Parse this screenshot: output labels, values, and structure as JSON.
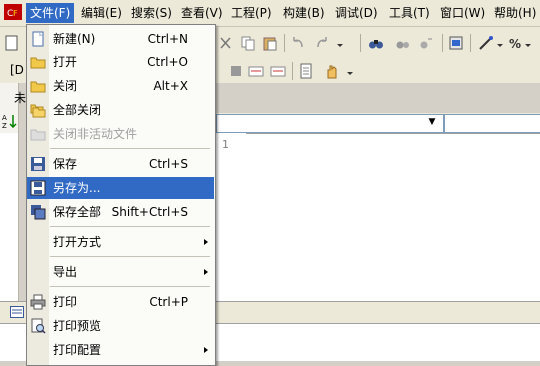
{
  "menubar": {
    "items": [
      {
        "label": "文件(F)",
        "active": true
      },
      {
        "label": "编辑(E)"
      },
      {
        "label": "搜索(S)"
      },
      {
        "label": "查看(V)"
      },
      {
        "label": "工程(P)"
      },
      {
        "label": "构建(B)"
      },
      {
        "label": "调试(D)"
      },
      {
        "label": "工具(T)"
      },
      {
        "label": "窗口(W)"
      },
      {
        "label": "帮助(H)"
      }
    ]
  },
  "toolbar": {
    "partial_left_label": "[D",
    "partial_tab_label": "未"
  },
  "editor": {
    "line_numbers": [
      "1"
    ]
  },
  "file_menu": {
    "items": [
      {
        "label": "新建(N)",
        "shortcut": "Ctrl+N",
        "icon": "new-file-icon"
      },
      {
        "label": "打开",
        "shortcut": "Ctrl+O",
        "icon": "open-folder-icon"
      },
      {
        "label": "关闭",
        "shortcut": "Alt+X",
        "icon": "close-folder-icon"
      },
      {
        "label": "全部关闭",
        "shortcut": "",
        "icon": "close-all-icon"
      },
      {
        "label": "关闭非活动文件",
        "shortcut": "",
        "icon": "close-inactive-icon",
        "disabled": true
      },
      {
        "label": "保存",
        "shortcut": "Ctrl+S",
        "icon": "save-icon"
      },
      {
        "label": "另存为...",
        "shortcut": "",
        "icon": "save-as-icon",
        "highlighted": true
      },
      {
        "label": "保存全部",
        "shortcut": "Shift+Ctrl+S",
        "icon": "save-all-icon"
      },
      {
        "label": "打开方式",
        "shortcut": "",
        "submenu": true
      },
      {
        "label": "导出",
        "shortcut": "",
        "submenu": true
      },
      {
        "label": "打印",
        "shortcut": "Ctrl+P",
        "icon": "print-icon"
      },
      {
        "label": "打印预览",
        "shortcut": "",
        "icon": "print-preview-icon"
      },
      {
        "label": "打印配置",
        "shortcut": "",
        "submenu": true
      }
    ]
  },
  "colors": {
    "highlight": "#316ac5",
    "menu_bg": "#fbfbf8",
    "chrome": "#ece9d8"
  }
}
